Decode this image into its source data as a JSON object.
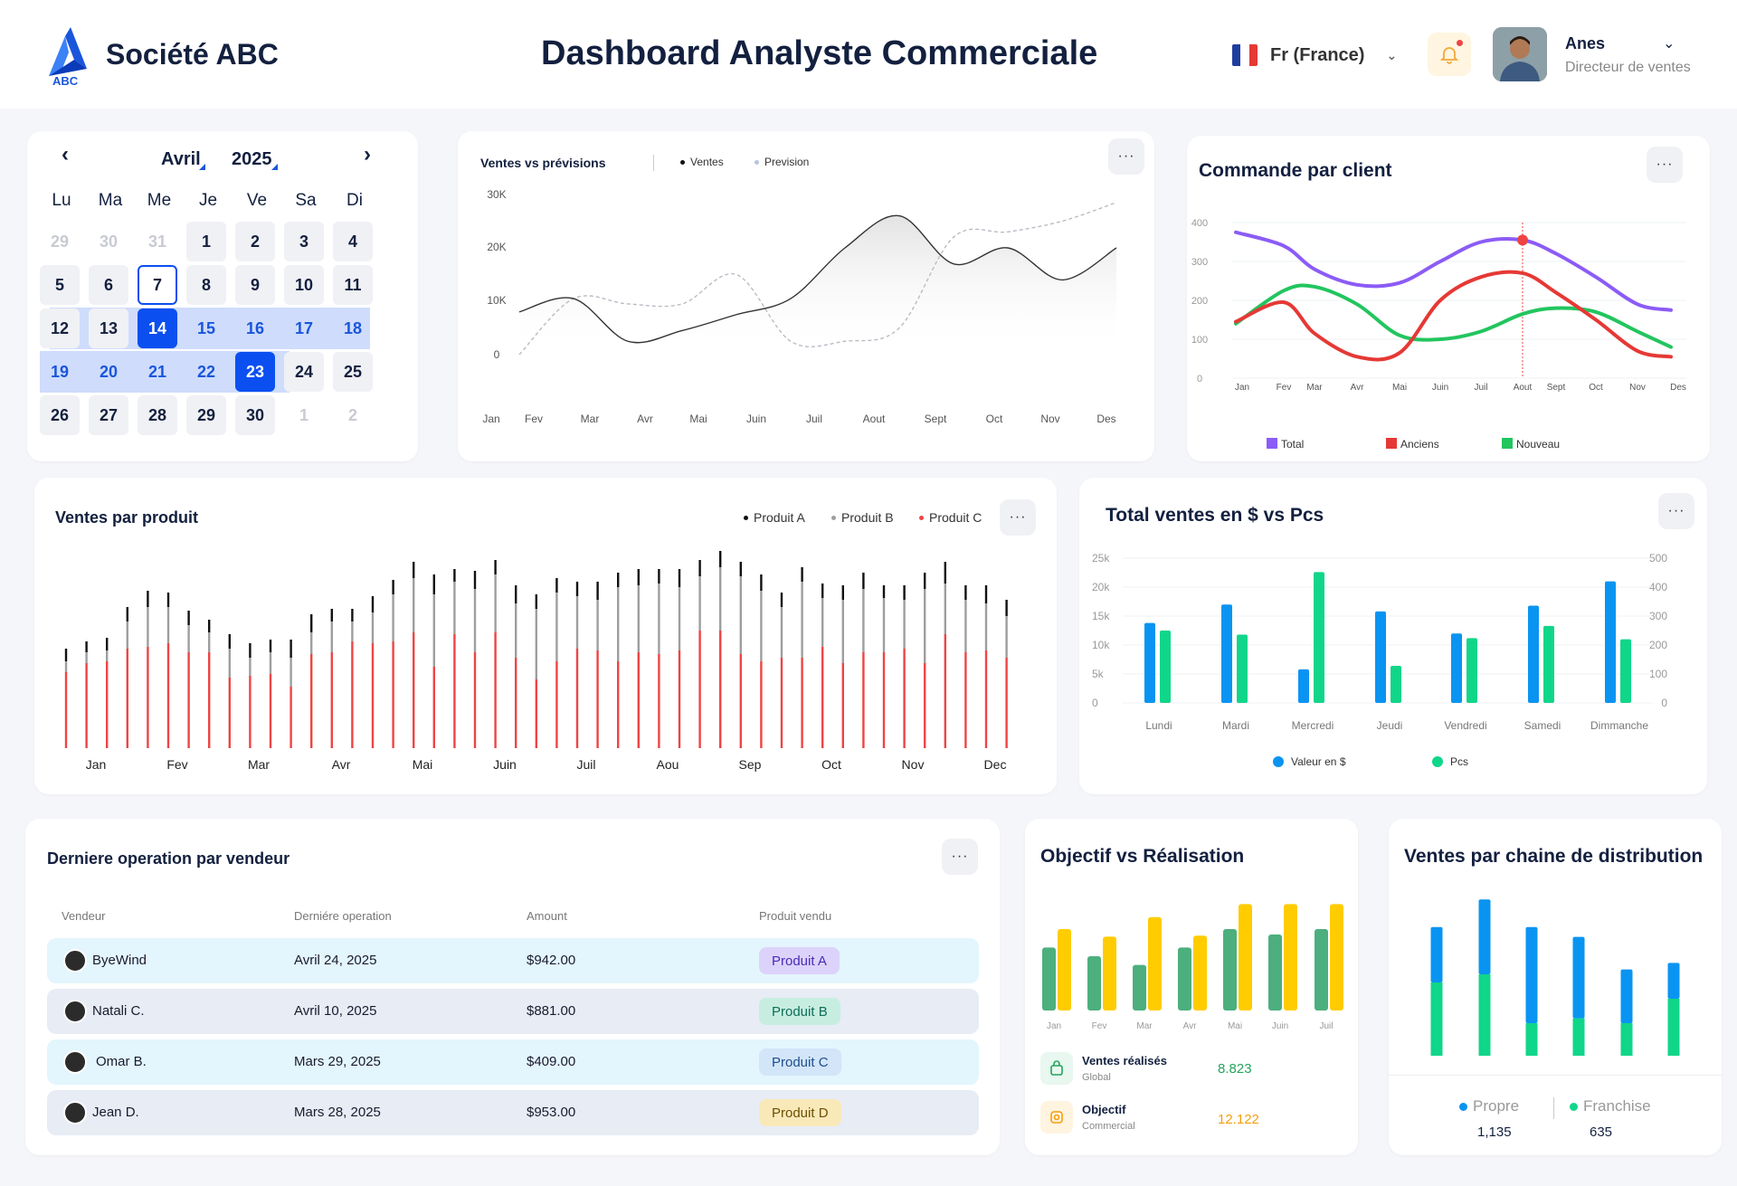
{
  "header": {
    "logo_text": "ABC",
    "company": "Société ABC",
    "title": "Dashboard Analyste Commerciale",
    "language": "Fr (France)",
    "user": {
      "name": "Anes",
      "role": "Directeur de ventes"
    }
  },
  "calendar": {
    "month": "Avril",
    "year": "2025",
    "weekdays": [
      "Lu",
      "Ma",
      "Me",
      "Je",
      "Ve",
      "Sa",
      "Di"
    ],
    "weeks": [
      [
        "29",
        "30",
        "31",
        "1",
        "2",
        "3",
        "4"
      ],
      [
        "5",
        "6",
        "7",
        "8",
        "9",
        "10",
        "11"
      ],
      [
        "12",
        "13",
        "14",
        "15",
        "16",
        "17",
        "18"
      ],
      [
        "19",
        "20",
        "21",
        "22",
        "23",
        "24",
        "25"
      ],
      [
        "26",
        "27",
        "28",
        "29",
        "30",
        "1",
        "2"
      ]
    ],
    "today": "7",
    "range_start": "14",
    "range_end": "23",
    "colors": {
      "accent": "#0b4ff0",
      "range": "#cfdcfc",
      "range_text": "#1a56db"
    }
  },
  "ventes_previsions": {
    "title": "Ventes vs prévisions",
    "more": "···",
    "chart_data": {
      "type": "line",
      "title": "Ventes vs prévisions",
      "categories": [
        "Jan",
        "Fev",
        "Mar",
        "Avr",
        "Mai",
        "Juin",
        "Juil",
        "Aout",
        "Sept",
        "Oct",
        "Nov",
        "Des"
      ],
      "yticks": [
        "30K",
        "20K",
        "10K",
        "0"
      ],
      "ylim": [
        0,
        30000
      ],
      "series": [
        {
          "name": "Ventes",
          "color": "#333333",
          "values": [
            8000,
            10500,
            2500,
            4500,
            7500,
            10500,
            20000,
            26000,
            17000,
            20000,
            14000,
            20000
          ]
        },
        {
          "name": "Prevision",
          "color": "#b8bcc4",
          "values": [
            0,
            10500,
            9500,
            9500,
            15000,
            2500,
            2500,
            5000,
            22000,
            23000,
            25000,
            28500
          ]
        }
      ]
    }
  },
  "commande_client": {
    "title": "Commande par client",
    "more": "···",
    "chart_data": {
      "type": "line",
      "title": "Commande par client",
      "categories": [
        "Jan",
        "Fev",
        "Mar",
        "Avr",
        "Mai",
        "Juin",
        "Juil",
        "Aout",
        "Sept",
        "Oct",
        "Nov",
        "Des"
      ],
      "yticks": [
        "400",
        "300",
        "200",
        "100",
        "0"
      ],
      "ylim": [
        0,
        400
      ],
      "highlight_category": "Aout",
      "series": [
        {
          "name": "Total",
          "color": "#8b5cf6",
          "values": [
            375,
            340,
            280,
            240,
            245,
            300,
            350,
            355,
            320,
            260,
            190,
            175
          ]
        },
        {
          "name": "Anciens",
          "color": "#e53935",
          "values": [
            145,
            195,
            115,
            55,
            65,
            200,
            260,
            270,
            220,
            150,
            70,
            55
          ]
        },
        {
          "name": "Nouveau",
          "color": "#22c55e",
          "values": [
            140,
            225,
            235,
            190,
            110,
            100,
            120,
            165,
            180,
            170,
            120,
            80
          ]
        }
      ]
    }
  },
  "ventes_produit": {
    "title": "Ventes par produit",
    "more": "···",
    "chart_data": {
      "type": "bar",
      "title": "Ventes par produit",
      "categories": [
        "Jan",
        "Fev",
        "Mar",
        "Avr",
        "Mai",
        "Juin",
        "Juil",
        "Aou",
        "Sep",
        "Oct",
        "Nov",
        "Dec"
      ],
      "series": [
        {
          "name": "Produit A",
          "color": "#111111"
        },
        {
          "name": "Produit B",
          "color": "#9e9e9e"
        },
        {
          "name": "Produit C",
          "color": "#ef4444"
        }
      ],
      "stacks": [
        [
          84,
          12,
          14
        ],
        [
          94,
          12,
          12
        ],
        [
          96,
          12,
          14
        ],
        [
          110,
          30,
          16
        ],
        [
          112,
          44,
          18
        ],
        [
          116,
          40,
          16
        ],
        [
          106,
          30,
          16
        ],
        [
          106,
          22,
          14
        ],
        [
          78,
          32,
          16
        ],
        [
          80,
          20,
          16
        ],
        [
          82,
          24,
          14
        ],
        [
          68,
          32,
          20
        ],
        [
          104,
          24,
          20
        ],
        [
          106,
          34,
          14
        ],
        [
          118,
          22,
          14
        ],
        [
          116,
          34,
          18
        ],
        [
          118,
          52,
          16
        ],
        [
          128,
          60,
          18
        ],
        [
          90,
          80,
          22
        ],
        [
          126,
          58,
          14
        ],
        [
          106,
          70,
          20
        ],
        [
          128,
          64,
          16
        ],
        [
          100,
          60,
          20
        ],
        [
          76,
          78,
          16
        ],
        [
          96,
          76,
          16
        ],
        [
          110,
          58,
          16
        ],
        [
          108,
          56,
          20
        ],
        [
          96,
          82,
          16
        ],
        [
          106,
          74,
          18
        ],
        [
          104,
          78,
          16
        ],
        [
          108,
          70,
          20
        ],
        [
          130,
          60,
          18
        ],
        [
          130,
          70,
          18
        ],
        [
          104,
          86,
          16
        ],
        [
          96,
          78,
          18
        ],
        [
          100,
          56,
          16
        ],
        [
          100,
          84,
          16
        ],
        [
          112,
          54,
          16
        ],
        [
          94,
          70,
          16
        ],
        [
          106,
          70,
          18
        ],
        [
          106,
          60,
          14
        ],
        [
          110,
          54,
          16
        ],
        [
          94,
          82,
          18
        ],
        [
          126,
          56,
          24
        ],
        [
          106,
          58,
          16
        ],
        [
          108,
          52,
          20
        ],
        [
          100,
          46,
          18
        ]
      ]
    }
  },
  "total_ventes": {
    "title": "Total ventes en $ vs Pcs",
    "more": "···",
    "chart_data": {
      "type": "bar",
      "title": "Total ventes en $ vs Pcs",
      "categories": [
        "Lundi",
        "Mardi",
        "Mercredi",
        "Jeudi",
        "Vendredi",
        "Samedi",
        "Dimmanche"
      ],
      "yticks_left": [
        "25k",
        "20k",
        "15k",
        "10k",
        "5k",
        "0"
      ],
      "yticks_right": [
        "500",
        "400",
        "300",
        "200",
        "100",
        "0"
      ],
      "ylim_left": [
        0,
        25000
      ],
      "ylim_right": [
        0,
        500
      ],
      "series": [
        {
          "name": "Valeur en $",
          "color": "#0a94f2",
          "values": [
            13800,
            17000,
            5800,
            15800,
            12000,
            16800,
            21000
          ]
        },
        {
          "name": "Pcs",
          "color": "#10d68a",
          "values": [
            250,
            236,
            452,
            128,
            224,
            266,
            220
          ]
        }
      ]
    }
  },
  "derniere_operation": {
    "title": "Derniere operation par vendeur",
    "more": "···",
    "columns": [
      "Vendeur",
      "Derniére operation",
      "Amount",
      "Produit vendu"
    ],
    "rows": [
      {
        "vendeur": "ByeWind",
        "date": "Avril 24, 2025",
        "amount": "$942.00",
        "produit": "Produit A",
        "bg": "#e3f5fd",
        "tag_bg": "#dcd3fb",
        "tag_color": "#4b2bb5"
      },
      {
        "vendeur": "Natali C.",
        "date": "Avril 10, 2025",
        "amount": "$881.00",
        "produit": "Produit B",
        "bg": "#e7ecf5",
        "tag_bg": "#c7ede1",
        "tag_color": "#0e6e56"
      },
      {
        "vendeur": "Omar B.",
        "date": "Mars 29, 2025",
        "amount": "$409.00",
        "produit": "Produit C",
        "bg": "#e3f5fd",
        "tag_bg": "#d2e5f9",
        "tag_color": "#1d4f8a"
      },
      {
        "vendeur": "Jean D.",
        "date": "Mars 28, 2025",
        "amount": "$953.00",
        "produit": "Produit D",
        "bg": "#e7ecf5",
        "tag_bg": "#f9e9b9",
        "tag_color": "#6b4f00"
      }
    ]
  },
  "objectif": {
    "title": "Objectif vs Réalisation",
    "chart_data": {
      "type": "bar",
      "title": "Objectif vs Réalisation",
      "categories": [
        "Jan",
        "Fev",
        "Mar",
        "Avr",
        "Mai",
        "Juin",
        "Juil"
      ],
      "series": [
        {
          "name": "Ventes réalisés",
          "color": "#4caf7d",
          "values": [
            0.58,
            0.5,
            0.42,
            0.58,
            0.75,
            0.7,
            0.75
          ]
        },
        {
          "name": "Objectif",
          "color": "#ffcc00",
          "values": [
            0.75,
            0.68,
            0.86,
            0.69,
            0.98,
            0.98,
            0.98
          ]
        }
      ]
    },
    "stats": [
      {
        "title": "Ventes réalisés",
        "sub": "Global",
        "value": "8.823",
        "color": "#22a45d",
        "icon": "shopping-bag-icon"
      },
      {
        "title": "Objectif",
        "sub": "Commercial",
        "value": "12.122",
        "color": "#f59e0b",
        "icon": "target-icon"
      }
    ]
  },
  "distribution": {
    "title": "Ventes par chaine de distribution",
    "chart_data": {
      "type": "bar",
      "title": "Ventes par chaine de distribution",
      "series": [
        {
          "name": "Propre",
          "color": "#0a94f2",
          "values": [
            0.34,
            0.46,
            0.59,
            0.5,
            0.33,
            0.22
          ]
        },
        {
          "name": "Franchise",
          "color": "#10d68a",
          "values": [
            0.45,
            0.5,
            0.2,
            0.23,
            0.2,
            0.35
          ]
        }
      ]
    },
    "legend": [
      {
        "name": "Propre",
        "value": "1,135",
        "color": "#0a94f2"
      },
      {
        "name": "Franchise",
        "value": "635",
        "color": "#10d68a"
      }
    ]
  }
}
